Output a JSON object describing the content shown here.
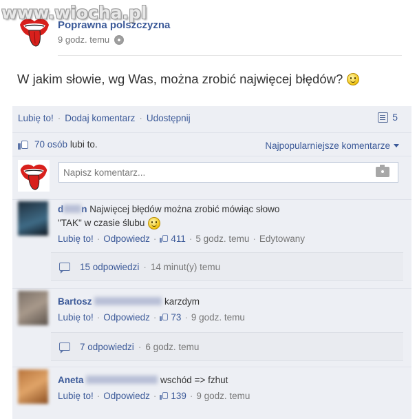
{
  "watermark": "www.wiocha.pl",
  "post": {
    "page_name": "Poprawna polszczyzna",
    "time": "9 godz. temu",
    "text": "W jakim słowie, wg Was, można zrobić najwięcej błędów?"
  },
  "actions": {
    "like": "Lubię to!",
    "comment": "Dodaj komentarz",
    "share": "Udostępnij",
    "comment_count": "5"
  },
  "likes": {
    "count": "70 osób",
    "suffix": "lubi to.",
    "sort": "Najpopularniejsze komentarze"
  },
  "composer": {
    "placeholder": "Napisz komentarz..."
  },
  "comments": [
    {
      "author": "d",
      "author_tail": "n",
      "text_line1": "Najwięcej błędów można zrobić mówiąc słowo",
      "text_line2": "\"TAK\" w czasie ślubu",
      "like": "Lubię to!",
      "reply": "Odpowiedz",
      "likes": "411",
      "time": "5 godz. temu",
      "edited": "Edytowany",
      "replies": "15 odpowiedzi",
      "replies_time": "14 minut(y) temu"
    },
    {
      "author": "Bartosz",
      "text": "karzdym",
      "like": "Lubię to!",
      "reply": "Odpowiedz",
      "likes": "73",
      "time": "9 godz. temu",
      "replies": "7 odpowiedzi",
      "replies_time": "6 godz. temu"
    },
    {
      "author": "Aneta",
      "text": "wschód => fzhut",
      "like": "Lubię to!",
      "reply": "Odpowiedz",
      "likes": "139",
      "time": "9 godz. temu"
    }
  ],
  "colors": {
    "link": "#3b5998",
    "panel": "#edeff4",
    "logo_red": "#d8201c"
  }
}
